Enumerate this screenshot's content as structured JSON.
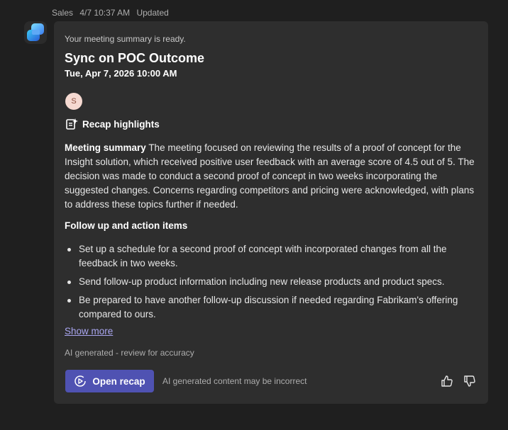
{
  "header": {
    "sender": "Sales",
    "timestamp": "4/7 10:37 AM",
    "status": "Updated"
  },
  "card": {
    "ready_text": "Your meeting summary is ready.",
    "title": "Sync on POC Outcome",
    "datetime": "Tue, Apr 7, 2026 10:00 AM",
    "participant_initial": "S",
    "recap_heading": "Recap highlights",
    "summary_label": "Meeting summary",
    "summary_text": "The meeting focused on reviewing the results of a proof of concept for the Insight solution, which received positive user feedback with an average score of 4.5 out of 5. The decision was made to conduct a second proof of concept in two weeks incorporating the suggested changes. Concerns regarding competitors and pricing were acknowledged, with plans to address these topics further if needed.",
    "follow_heading": "Follow up and action items",
    "actions": [
      "Set up a schedule for a second proof of concept with incorporated changes from all the feedback in two weeks.",
      "Send follow-up product information including new release products and product specs.",
      "Be prepared to have another follow-up discussion if needed regarding Fabrikam's offering compared to ours."
    ],
    "show_more": "Show more",
    "ai_note": "AI generated - review for accuracy",
    "open_recap_label": "Open recap",
    "disclaimer": "AI generated content may be incorrect"
  },
  "icons": {
    "app": "copilot-app-icon",
    "recap": "recap-sparkle-icon",
    "open_recap": "play-circle-icon",
    "like": "thumbs-up-icon",
    "dislike": "thumbs-down-icon"
  },
  "colors": {
    "accent": "#4f52b2",
    "link": "#a9a6f0",
    "card_bg": "#2e2e2e",
    "page_bg": "#1f1f1f"
  }
}
